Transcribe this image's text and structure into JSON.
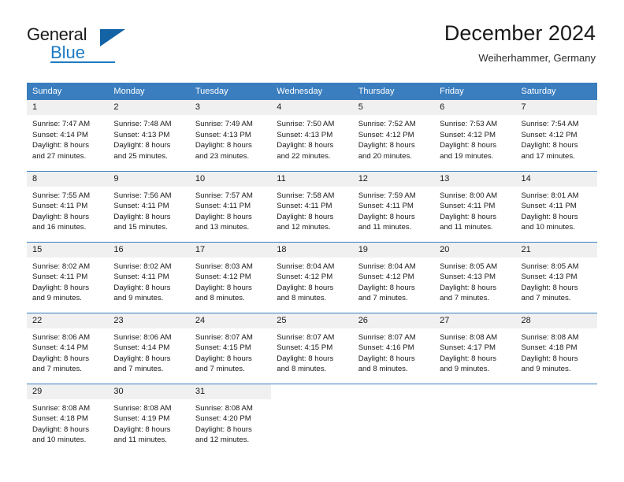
{
  "brand": {
    "name_part1": "General",
    "name_part2": "Blue",
    "triangle_color": "#1464a5",
    "accent_color": "#1e7bc4"
  },
  "header": {
    "title": "December 2024",
    "subtitle": "Weiherhammer, Germany"
  },
  "theme": {
    "header_bg": "#3a7ebf",
    "daynum_bg": "#f0f0f0",
    "text": "#1a1a1a"
  },
  "weekdays": [
    "Sunday",
    "Monday",
    "Tuesday",
    "Wednesday",
    "Thursday",
    "Friday",
    "Saturday"
  ],
  "days": [
    {
      "n": "1",
      "sunrise": "Sunrise: 7:47 AM",
      "sunset": "Sunset: 4:14 PM",
      "daylight1": "Daylight: 8 hours",
      "daylight2": "and 27 minutes."
    },
    {
      "n": "2",
      "sunrise": "Sunrise: 7:48 AM",
      "sunset": "Sunset: 4:13 PM",
      "daylight1": "Daylight: 8 hours",
      "daylight2": "and 25 minutes."
    },
    {
      "n": "3",
      "sunrise": "Sunrise: 7:49 AM",
      "sunset": "Sunset: 4:13 PM",
      "daylight1": "Daylight: 8 hours",
      "daylight2": "and 23 minutes."
    },
    {
      "n": "4",
      "sunrise": "Sunrise: 7:50 AM",
      "sunset": "Sunset: 4:13 PM",
      "daylight1": "Daylight: 8 hours",
      "daylight2": "and 22 minutes."
    },
    {
      "n": "5",
      "sunrise": "Sunrise: 7:52 AM",
      "sunset": "Sunset: 4:12 PM",
      "daylight1": "Daylight: 8 hours",
      "daylight2": "and 20 minutes."
    },
    {
      "n": "6",
      "sunrise": "Sunrise: 7:53 AM",
      "sunset": "Sunset: 4:12 PM",
      "daylight1": "Daylight: 8 hours",
      "daylight2": "and 19 minutes."
    },
    {
      "n": "7",
      "sunrise": "Sunrise: 7:54 AM",
      "sunset": "Sunset: 4:12 PM",
      "daylight1": "Daylight: 8 hours",
      "daylight2": "and 17 minutes."
    },
    {
      "n": "8",
      "sunrise": "Sunrise: 7:55 AM",
      "sunset": "Sunset: 4:11 PM",
      "daylight1": "Daylight: 8 hours",
      "daylight2": "and 16 minutes."
    },
    {
      "n": "9",
      "sunrise": "Sunrise: 7:56 AM",
      "sunset": "Sunset: 4:11 PM",
      "daylight1": "Daylight: 8 hours",
      "daylight2": "and 15 minutes."
    },
    {
      "n": "10",
      "sunrise": "Sunrise: 7:57 AM",
      "sunset": "Sunset: 4:11 PM",
      "daylight1": "Daylight: 8 hours",
      "daylight2": "and 13 minutes."
    },
    {
      "n": "11",
      "sunrise": "Sunrise: 7:58 AM",
      "sunset": "Sunset: 4:11 PM",
      "daylight1": "Daylight: 8 hours",
      "daylight2": "and 12 minutes."
    },
    {
      "n": "12",
      "sunrise": "Sunrise: 7:59 AM",
      "sunset": "Sunset: 4:11 PM",
      "daylight1": "Daylight: 8 hours",
      "daylight2": "and 11 minutes."
    },
    {
      "n": "13",
      "sunrise": "Sunrise: 8:00 AM",
      "sunset": "Sunset: 4:11 PM",
      "daylight1": "Daylight: 8 hours",
      "daylight2": "and 11 minutes."
    },
    {
      "n": "14",
      "sunrise": "Sunrise: 8:01 AM",
      "sunset": "Sunset: 4:11 PM",
      "daylight1": "Daylight: 8 hours",
      "daylight2": "and 10 minutes."
    },
    {
      "n": "15",
      "sunrise": "Sunrise: 8:02 AM",
      "sunset": "Sunset: 4:11 PM",
      "daylight1": "Daylight: 8 hours",
      "daylight2": "and 9 minutes."
    },
    {
      "n": "16",
      "sunrise": "Sunrise: 8:02 AM",
      "sunset": "Sunset: 4:11 PM",
      "daylight1": "Daylight: 8 hours",
      "daylight2": "and 9 minutes."
    },
    {
      "n": "17",
      "sunrise": "Sunrise: 8:03 AM",
      "sunset": "Sunset: 4:12 PM",
      "daylight1": "Daylight: 8 hours",
      "daylight2": "and 8 minutes."
    },
    {
      "n": "18",
      "sunrise": "Sunrise: 8:04 AM",
      "sunset": "Sunset: 4:12 PM",
      "daylight1": "Daylight: 8 hours",
      "daylight2": "and 8 minutes."
    },
    {
      "n": "19",
      "sunrise": "Sunrise: 8:04 AM",
      "sunset": "Sunset: 4:12 PM",
      "daylight1": "Daylight: 8 hours",
      "daylight2": "and 7 minutes."
    },
    {
      "n": "20",
      "sunrise": "Sunrise: 8:05 AM",
      "sunset": "Sunset: 4:13 PM",
      "daylight1": "Daylight: 8 hours",
      "daylight2": "and 7 minutes."
    },
    {
      "n": "21",
      "sunrise": "Sunrise: 8:05 AM",
      "sunset": "Sunset: 4:13 PM",
      "daylight1": "Daylight: 8 hours",
      "daylight2": "and 7 minutes."
    },
    {
      "n": "22",
      "sunrise": "Sunrise: 8:06 AM",
      "sunset": "Sunset: 4:14 PM",
      "daylight1": "Daylight: 8 hours",
      "daylight2": "and 7 minutes."
    },
    {
      "n": "23",
      "sunrise": "Sunrise: 8:06 AM",
      "sunset": "Sunset: 4:14 PM",
      "daylight1": "Daylight: 8 hours",
      "daylight2": "and 7 minutes."
    },
    {
      "n": "24",
      "sunrise": "Sunrise: 8:07 AM",
      "sunset": "Sunset: 4:15 PM",
      "daylight1": "Daylight: 8 hours",
      "daylight2": "and 7 minutes."
    },
    {
      "n": "25",
      "sunrise": "Sunrise: 8:07 AM",
      "sunset": "Sunset: 4:15 PM",
      "daylight1": "Daylight: 8 hours",
      "daylight2": "and 8 minutes."
    },
    {
      "n": "26",
      "sunrise": "Sunrise: 8:07 AM",
      "sunset": "Sunset: 4:16 PM",
      "daylight1": "Daylight: 8 hours",
      "daylight2": "and 8 minutes."
    },
    {
      "n": "27",
      "sunrise": "Sunrise: 8:08 AM",
      "sunset": "Sunset: 4:17 PM",
      "daylight1": "Daylight: 8 hours",
      "daylight2": "and 9 minutes."
    },
    {
      "n": "28",
      "sunrise": "Sunrise: 8:08 AM",
      "sunset": "Sunset: 4:18 PM",
      "daylight1": "Daylight: 8 hours",
      "daylight2": "and 9 minutes."
    },
    {
      "n": "29",
      "sunrise": "Sunrise: 8:08 AM",
      "sunset": "Sunset: 4:18 PM",
      "daylight1": "Daylight: 8 hours",
      "daylight2": "and 10 minutes."
    },
    {
      "n": "30",
      "sunrise": "Sunrise: 8:08 AM",
      "sunset": "Sunset: 4:19 PM",
      "daylight1": "Daylight: 8 hours",
      "daylight2": "and 11 minutes."
    },
    {
      "n": "31",
      "sunrise": "Sunrise: 8:08 AM",
      "sunset": "Sunset: 4:20 PM",
      "daylight1": "Daylight: 8 hours",
      "daylight2": "and 12 minutes."
    }
  ],
  "grid": {
    "leading_blanks": 0,
    "trailing_blanks": 4,
    "columns": 7
  }
}
